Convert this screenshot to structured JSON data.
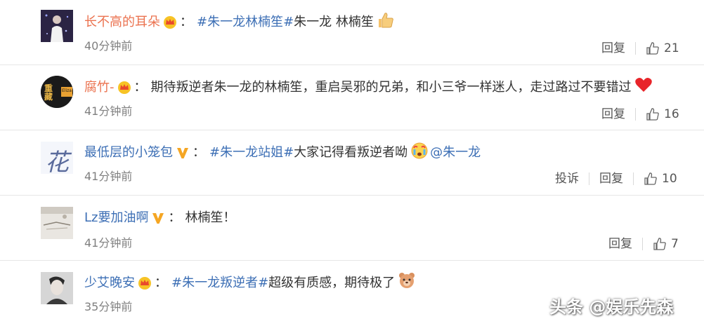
{
  "comments": [
    {
      "user": "长不高的耳朵",
      "colon": "：",
      "tag": "#朱一龙林楠笙#",
      "text": "朱一龙 林楠笙",
      "time": "40分钟前",
      "reply": "回复",
      "likes": "21",
      "badge": "crown-badge-icon",
      "emoji": "thumbs-up-emoji"
    },
    {
      "user": "腐竹-",
      "colon": "：",
      "text": "期待叛逆者朱一龙的林楠笙，重启吴邪的兄弟，和小三爷一样迷人，走过路过不要错过",
      "time": "41分钟前",
      "reply": "回复",
      "likes": "16",
      "badge": "crown-badge-icon",
      "emoji": "red-heart-emoji"
    },
    {
      "user": "最低层的小笼包",
      "colon": "：",
      "tag": "#朱一龙站姐#",
      "text": "大家记得看叛逆者呦",
      "mention": "@朱一龙",
      "time": "41分钟前",
      "report": "投诉",
      "reply": "回复",
      "likes": "10",
      "badge": "v-badge-icon",
      "emoji": "crying-face-emoji"
    },
    {
      "user": "Lz要加油啊",
      "colon": "：",
      "text": "林楠笙！",
      "time": "41分钟前",
      "reply": "回复",
      "likes": "7",
      "badge": "v-badge-icon"
    },
    {
      "user": "少艾晚安",
      "colon": "：",
      "tag": "#朱一龙叛逆者#",
      "text": "超级有质感，期待极了",
      "time": "35分钟前",
      "badge": "crown-badge-icon",
      "emoji": "bear-face-emoji"
    }
  ],
  "avatars": {
    "a2_text": "重藏",
    "a2_sub": "Eliza",
    "a3_text": "花"
  },
  "watermark": "头条 @娱乐先森",
  "colors": {
    "username_orange": "#eb7350",
    "link_blue": "#3d6fb5",
    "gray_text": "#808080",
    "divider": "#e6e6e6"
  }
}
